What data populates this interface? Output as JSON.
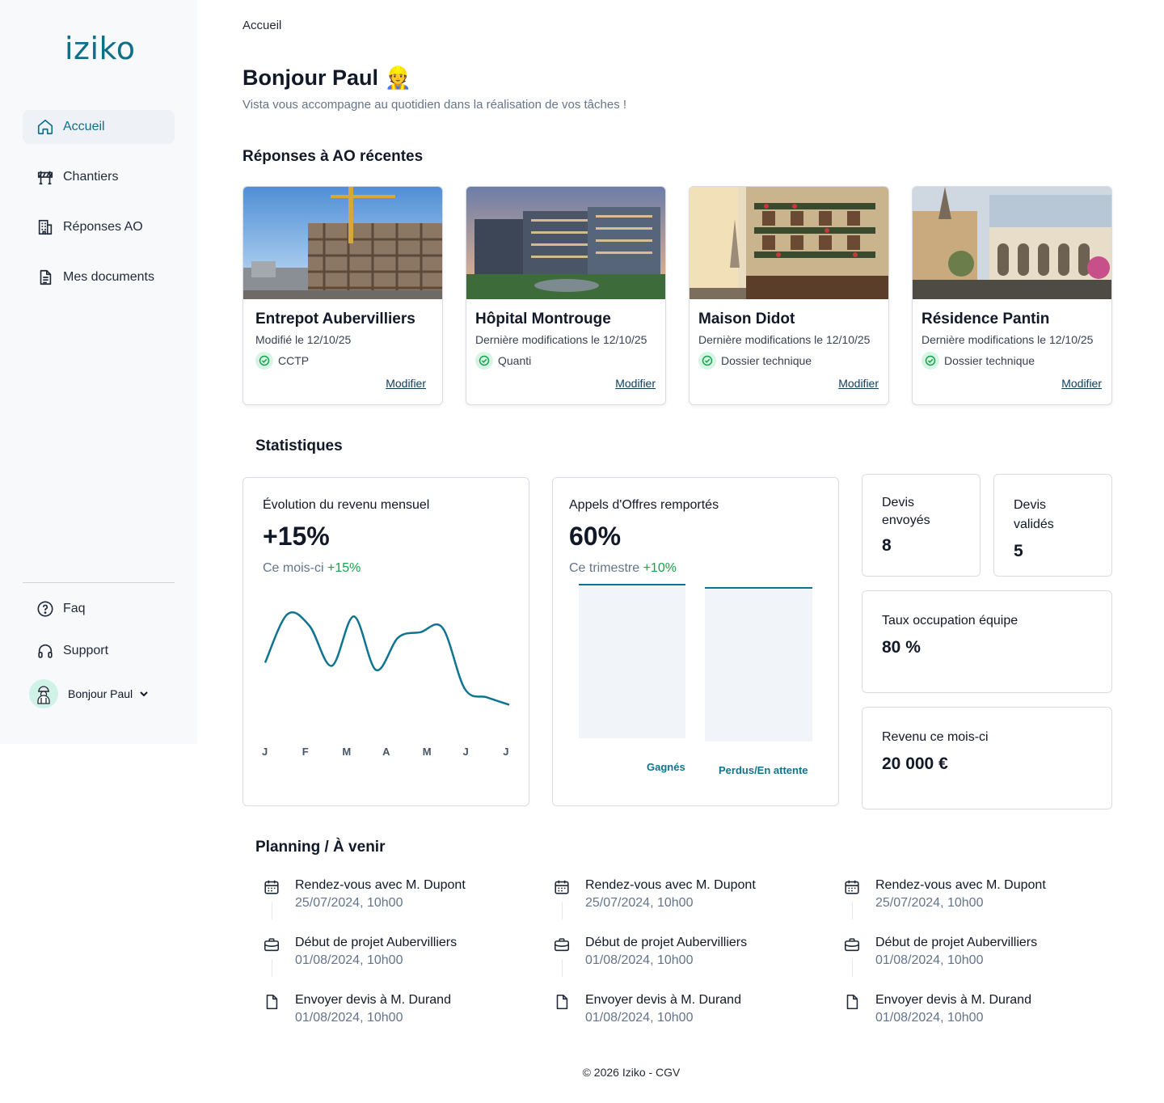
{
  "app": {
    "logo": "iziko"
  },
  "sidebar": {
    "items": [
      {
        "label": "Accueil",
        "icon": "home-icon"
      },
      {
        "label": "Chantiers",
        "icon": "barrier-icon"
      },
      {
        "label": "Réponses AO",
        "icon": "building-icon"
      },
      {
        "label": "Mes documents",
        "icon": "document-icon"
      }
    ],
    "bottom": [
      {
        "label": "Faq",
        "icon": "question-icon"
      },
      {
        "label": "Support",
        "icon": "headphones-icon"
      }
    ],
    "user": {
      "label": "Bonjour Paul"
    }
  },
  "header": {
    "breadcrumb": "Accueil",
    "greeting": "Bonjour Paul 👷",
    "subtitle": "Vista vous accompagne au quotidien dans la réalisation de vos tâches !"
  },
  "recent": {
    "title": "Réponses à AO récentes",
    "cards": [
      {
        "title": "Entrepot Aubervilliers",
        "date": "Modifié le 12/10/25",
        "status": "CCTP",
        "action": "Modifier"
      },
      {
        "title": "Hôpital Montrouge",
        "date": "Dernière modifications le 12/10/25",
        "status": "Quanti",
        "action": "Modifier"
      },
      {
        "title": "Maison Didot",
        "date": "Dernière modifications le 12/10/25",
        "status": "Dossier technique",
        "action": "Modifier"
      },
      {
        "title": "Résidence Pantin",
        "date": "Dernière modifications le 12/10/25",
        "status": "Dossier technique",
        "action": "Modifier"
      }
    ]
  },
  "stats": {
    "title": "Statistiques",
    "revenue": {
      "title": "Évolution du revenu mensuel",
      "value": "+15%",
      "sub": "Ce mois-ci",
      "delta": "+15%"
    },
    "ao": {
      "title": "Appels d'Offres remportés",
      "value": "60%",
      "sub": "Ce trimestre",
      "delta": "+10%"
    },
    "devis_envoyes": {
      "label": "Devis envoyés",
      "value": "8"
    },
    "devis_valides": {
      "label": "Devis validés",
      "value": "5"
    },
    "occupation": {
      "label": "Taux occupation équipe",
      "value": "80 %"
    },
    "revenu_mois": {
      "label": "Revenu ce mois-ci",
      "value": "20 000 €"
    }
  },
  "chart_data": [
    {
      "type": "line",
      "categories": [
        "J",
        "F",
        "M",
        "A",
        "M",
        "J",
        "J"
      ],
      "series": [
        {
          "values": [
            45,
            91,
            80,
            42,
            89,
            38,
            69,
            74,
            78,
            20,
            12,
            5
          ]
        }
      ],
      "ylim": [
        0,
        100
      ],
      "grid": false,
      "color": "#0e7490"
    },
    {
      "type": "bar",
      "categories": [
        "Gagnés",
        "Perdus/En attente"
      ],
      "values": [
        100,
        100
      ],
      "color": "#f1f4f9",
      "edge_color": "#0e7490"
    }
  ],
  "planning": {
    "title": "Planning / À venir",
    "columns": [
      [
        {
          "icon": "calendar-icon",
          "title": "Rendez-vous avec M. Dupont",
          "date": "25/07/2024, 10h00"
        },
        {
          "icon": "briefcase-icon",
          "title": "Début de projet Aubervilliers",
          "date": "01/08/2024, 10h00"
        },
        {
          "icon": "file-icon",
          "title": "Envoyer devis à M. Durand",
          "date": "01/08/2024, 10h00"
        }
      ],
      [
        {
          "icon": "calendar-icon",
          "title": "Rendez-vous avec M. Dupont",
          "date": "25/07/2024, 10h00"
        },
        {
          "icon": "briefcase-icon",
          "title": "Début de projet Aubervilliers",
          "date": "01/08/2024, 10h00"
        },
        {
          "icon": "file-icon",
          "title": "Envoyer devis à M. Durand",
          "date": "01/08/2024, 10h00"
        }
      ],
      [
        {
          "icon": "calendar-icon",
          "title": "Rendez-vous avec M. Dupont",
          "date": "25/07/2024, 10h00"
        },
        {
          "icon": "briefcase-icon",
          "title": "Début de projet Aubervilliers",
          "date": "01/08/2024, 10h00"
        },
        {
          "icon": "file-icon",
          "title": "Envoyer devis à M. Durand",
          "date": "01/08/2024, 10h00"
        }
      ]
    ]
  },
  "footer": {
    "text": "© 2026 Iziko - CGV"
  },
  "colors": {
    "brand": "#0e6f8a",
    "accent_green": "#16a34a",
    "text_muted": "#64748b"
  }
}
